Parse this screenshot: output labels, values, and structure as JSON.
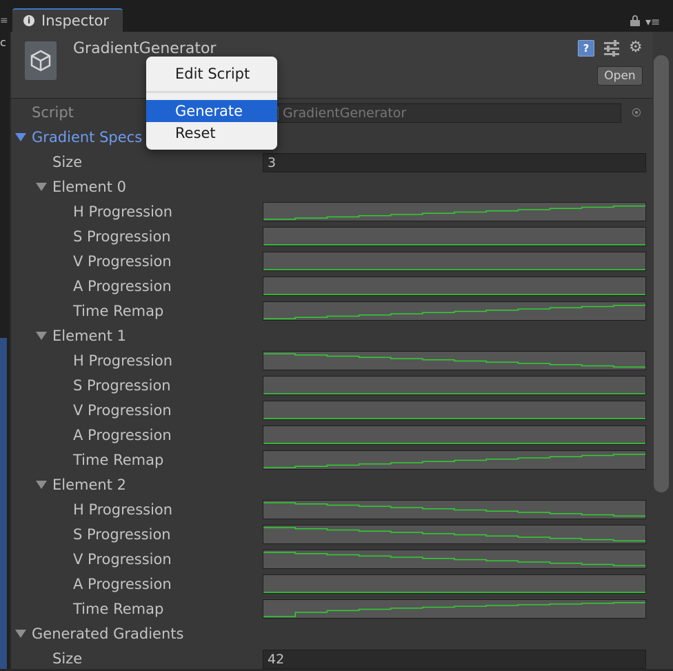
{
  "window": {
    "tab_label": "Inspector"
  },
  "header": {
    "object_title": "GradientGenerator",
    "open_label": "Open",
    "help_glyph": "?"
  },
  "script_row": {
    "label": "Script",
    "value": "GradientGenerator"
  },
  "gradient_specs": {
    "label": "Gradient Specs",
    "size_label": "Size",
    "size_value": "3",
    "elements": [
      {
        "label": "Element 0",
        "fields": [
          {
            "label": "H Progression",
            "trend": "up"
          },
          {
            "label": "S Progression",
            "trend": "flat-low"
          },
          {
            "label": "V Progression",
            "trend": "flat-low"
          },
          {
            "label": "A Progression",
            "trend": "flat-low"
          },
          {
            "label": "Time Remap",
            "trend": "up"
          }
        ]
      },
      {
        "label": "Element 1",
        "fields": [
          {
            "label": "H Progression",
            "trend": "down"
          },
          {
            "label": "S Progression",
            "trend": "flat-low"
          },
          {
            "label": "V Progression",
            "trend": "flat-low"
          },
          {
            "label": "A Progression",
            "trend": "flat-low"
          },
          {
            "label": "Time Remap",
            "trend": "up"
          }
        ]
      },
      {
        "label": "Element 2",
        "fields": [
          {
            "label": "H Progression",
            "trend": "down"
          },
          {
            "label": "S Progression",
            "trend": "down"
          },
          {
            "label": "V Progression",
            "trend": "down"
          },
          {
            "label": "A Progression",
            "trend": "flat-low"
          },
          {
            "label": "Time Remap",
            "trend": "up-ease"
          }
        ]
      }
    ]
  },
  "generated_gradients": {
    "label": "Generated Gradients",
    "size_label": "Size",
    "size_value": "42"
  },
  "context_menu": {
    "items": [
      "Edit Script",
      "Generate",
      "Reset"
    ],
    "active_item": "Generate"
  },
  "colors": {
    "curve": "#2fd12f",
    "accent_blue": "#1f63d1",
    "foldout_blue": "#6d9cf2"
  }
}
